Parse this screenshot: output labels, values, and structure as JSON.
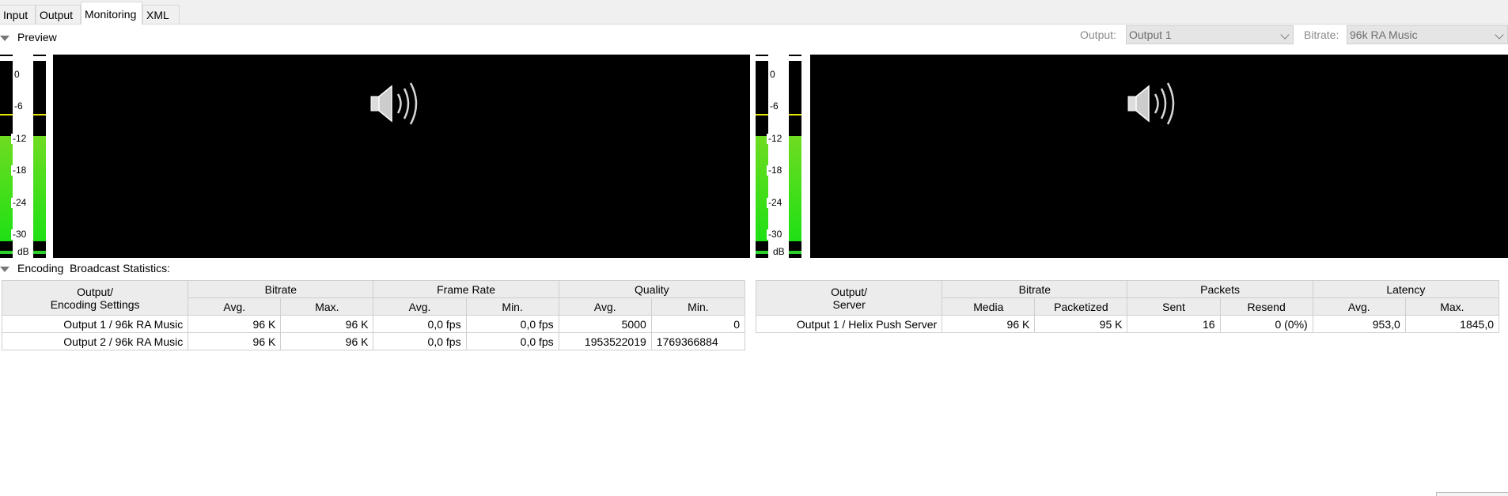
{
  "tabs": [
    "Input",
    "Output",
    "Monitoring",
    "XML"
  ],
  "active_tab": "Monitoring",
  "preview": {
    "title": "Preview",
    "output_label": "Output:",
    "output_value": "Output 1",
    "bitrate_label": "Bitrate:",
    "bitrate_value": "96k RA Music"
  },
  "meter": {
    "ticks": [
      "0",
      "-6",
      "-12",
      "-18",
      "-24",
      "-30"
    ],
    "unit": "dB"
  },
  "stats": {
    "title": "Encoding  Broadcast Statistics:",
    "left": {
      "header_output": [
        "Output/",
        "Encoding Settings"
      ],
      "groups": [
        "Bitrate",
        "Frame Rate",
        "Quality"
      ],
      "subheaders": [
        "Avg.",
        "Max.",
        "Avg.",
        "Min.",
        "Avg.",
        "Min."
      ],
      "rows": [
        [
          "Output 1 / 96k RA Music",
          "96 K",
          "96 K",
          "0,0 fps",
          "0,0 fps",
          "5000",
          "0"
        ],
        [
          "Output 2 / 96k RA Music",
          "96 K",
          "96 K",
          "0,0 fps",
          "0,0 fps",
          "1953522019",
          "1769366884"
        ]
      ]
    },
    "right": {
      "header_output": [
        "Output/",
        "Server"
      ],
      "groups": [
        "Bitrate",
        "Packets",
        "Latency"
      ],
      "subheaders": [
        "Media",
        "Packetized",
        "Sent",
        "Resend",
        "Avg.",
        "Max."
      ],
      "rows": [
        [
          "Output 1 / Helix Push Server",
          "96 K",
          "95 K",
          "16",
          "0 (0%)",
          "953,0",
          "1845,0"
        ]
      ]
    }
  }
}
